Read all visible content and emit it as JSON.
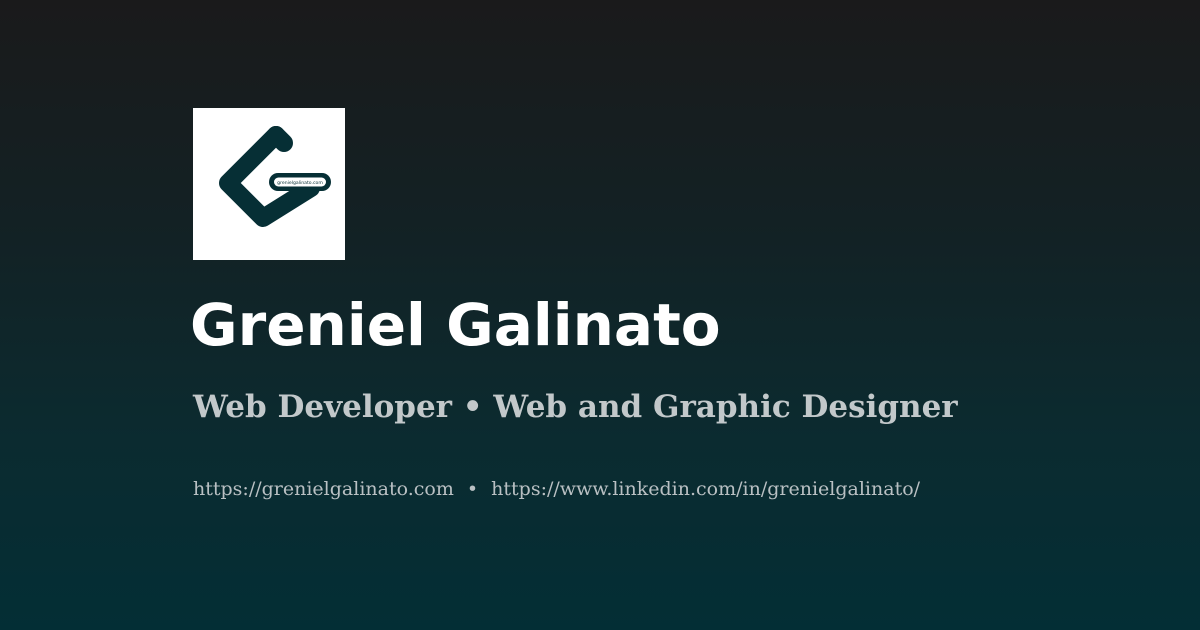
{
  "logo": {
    "small_text": "grenielgalinato.com",
    "background": "#ffffff",
    "mark_color": "#062f35"
  },
  "profile": {
    "name": "Greniel Galinato",
    "roles": "Web Developer • Web and Graphic Designer",
    "links": {
      "website": "https://grenielgalinato.com",
      "separator": "•",
      "linkedin": "https://www.linkedin.com/in/grenielgalinato/"
    }
  },
  "colors": {
    "background_top": "#1a1a1b",
    "background_bottom": "#032e35",
    "name": "#ffffff",
    "roles": "#c2c8ca",
    "links": "#b9c0c3"
  }
}
